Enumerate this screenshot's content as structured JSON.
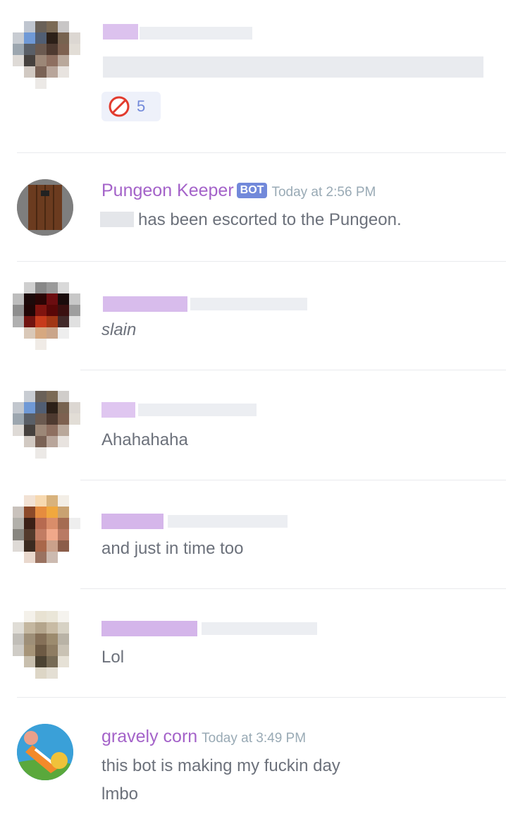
{
  "messages": [
    {
      "id": "m1",
      "reaction": {
        "emoji": "PUN",
        "count": "5"
      }
    },
    {
      "id": "m2",
      "author": "Pungeon Keeper",
      "badge": "BOT",
      "timestamp": "Today at 2:56 PM",
      "text": "has been escorted to the Pungeon."
    },
    {
      "id": "m3",
      "text": "slain"
    },
    {
      "id": "m4",
      "text": "Ahahahaha"
    },
    {
      "id": "m5",
      "text": "and just in time too"
    },
    {
      "id": "m6",
      "text": "Lol"
    },
    {
      "id": "m7",
      "author": "gravely corn",
      "timestamp": "Today at 3:49 PM",
      "lines": [
        "this bot is making my fuckin day",
        "lmbo"
      ]
    }
  ],
  "colors": {
    "author": "#a463c9",
    "timestamp": "#99aab5",
    "body_text": "#6c717b",
    "bot_badge": "#7289da",
    "divider": "#e9eaed",
    "reaction_bg": "#eef1fa"
  },
  "icons": {
    "reaction": "no-pun-icon",
    "pungeon_avatar": "dungeon-door-icon",
    "corn_avatar": "cartoon-avatar-icon"
  }
}
